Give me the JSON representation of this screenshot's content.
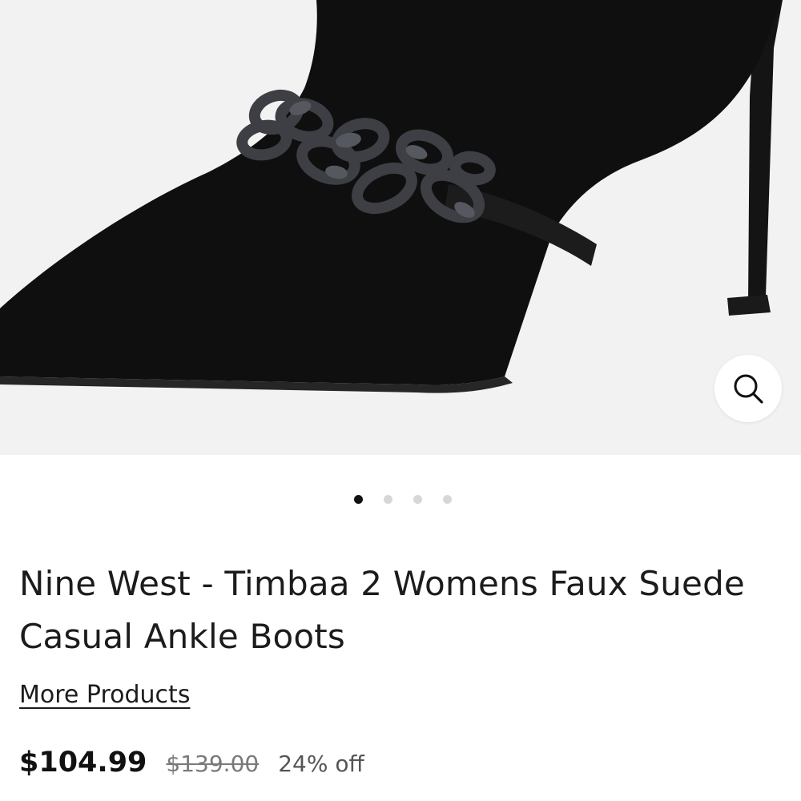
{
  "gallery": {
    "image_alt": "Black faux suede pointed-toe ankle boot with gunmetal chain strap and stiletto heel",
    "dots": [
      {
        "active": true
      },
      {
        "active": false
      },
      {
        "active": false
      },
      {
        "active": false
      }
    ],
    "zoom_icon": "search-icon"
  },
  "product": {
    "title": "Nine West - Timbaa 2 Womens Faux Suede Casual Ankle Boots",
    "more_products_label": "More Products",
    "price_current": "$104.99",
    "price_original": "$139.00",
    "discount": "24% off"
  },
  "colors": {
    "boot": "#0f0f0f",
    "chain": "#3d3f44",
    "background": "#f2f2f2",
    "active_dot": "#111111",
    "inactive_dot": "#d7d7d7"
  }
}
